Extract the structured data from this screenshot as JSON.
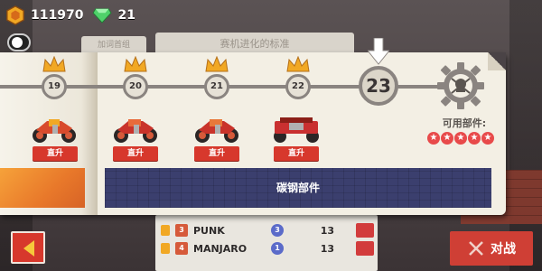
{
  "hud": {
    "coins": "111970",
    "gems": "21"
  },
  "background": {
    "tab_label": "加词首组",
    "title": "赛机进化的标准",
    "rows": [
      {
        "rank": "3",
        "name": "PUNK",
        "level": "3",
        "score": "13"
      },
      {
        "rank": "4",
        "name": "MANJARO",
        "level": "1",
        "score": "13"
      }
    ]
  },
  "progression": {
    "nodes": [
      "19",
      "20",
      "21",
      "22"
    ],
    "current": "23",
    "available_label": "可用部件:",
    "star_count": 5
  },
  "bikes": {
    "upgrade_label": "直升"
  },
  "part_strip": {
    "label": "碳钢部件"
  },
  "actions": {
    "fight_label": "对战"
  },
  "colors": {
    "accent_red": "#d7382c",
    "gold": "#f1a824",
    "panel": "#f3efe4",
    "track": "#8a8480"
  }
}
